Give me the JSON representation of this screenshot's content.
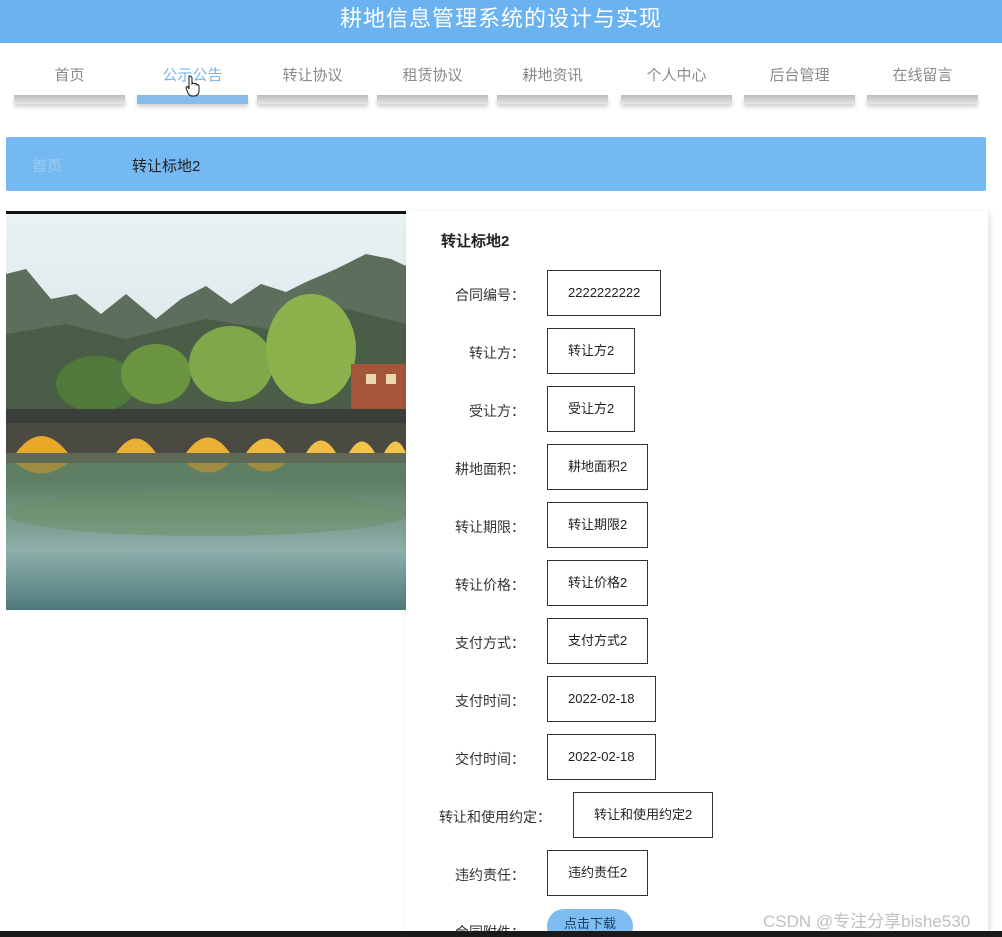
{
  "header": {
    "title": "耕地信息管理系统的设计与实现"
  },
  "nav": {
    "items": [
      {
        "label": "首页"
      },
      {
        "label": "公示公告",
        "active": true
      },
      {
        "label": "转让协议"
      },
      {
        "label": "租赁协议"
      },
      {
        "label": "耕地资讯"
      },
      {
        "label": "个人中心"
      },
      {
        "label": "后台管理"
      },
      {
        "label": "在线留言"
      }
    ]
  },
  "breadcrumb": {
    "home": "首页",
    "current": "转让标地2"
  },
  "detail": {
    "title": "转让标地2",
    "fields": [
      {
        "label": "合同编号：",
        "value": "2222222222"
      },
      {
        "label": "转让方：",
        "value": "转让方2"
      },
      {
        "label": "受让方：",
        "value": "受让方2"
      },
      {
        "label": "耕地面积：",
        "value": "耕地面积2"
      },
      {
        "label": "转让期限：",
        "value": "转让期限2"
      },
      {
        "label": "转让价格：",
        "value": "转让价格2"
      },
      {
        "label": "支付方式：",
        "value": "支付方式2"
      },
      {
        "label": "支付时间：",
        "value": "2022-02-18"
      },
      {
        "label": "交付时间：",
        "value": "2022-02-18"
      },
      {
        "label": "转让和使用约定：",
        "value": "转让和使用约定2"
      },
      {
        "label": "违约责任：",
        "value": "违约责任2"
      }
    ],
    "attachment": {
      "label": "合同附件：",
      "button": "点击下载"
    }
  },
  "watermark": "CSDN @专注分享bishe530",
  "colors": {
    "header": "#6bb3f0",
    "breadcrumb": "#75b9f2",
    "active_nav": "#79b6ea",
    "button": "#7dbdf2"
  }
}
